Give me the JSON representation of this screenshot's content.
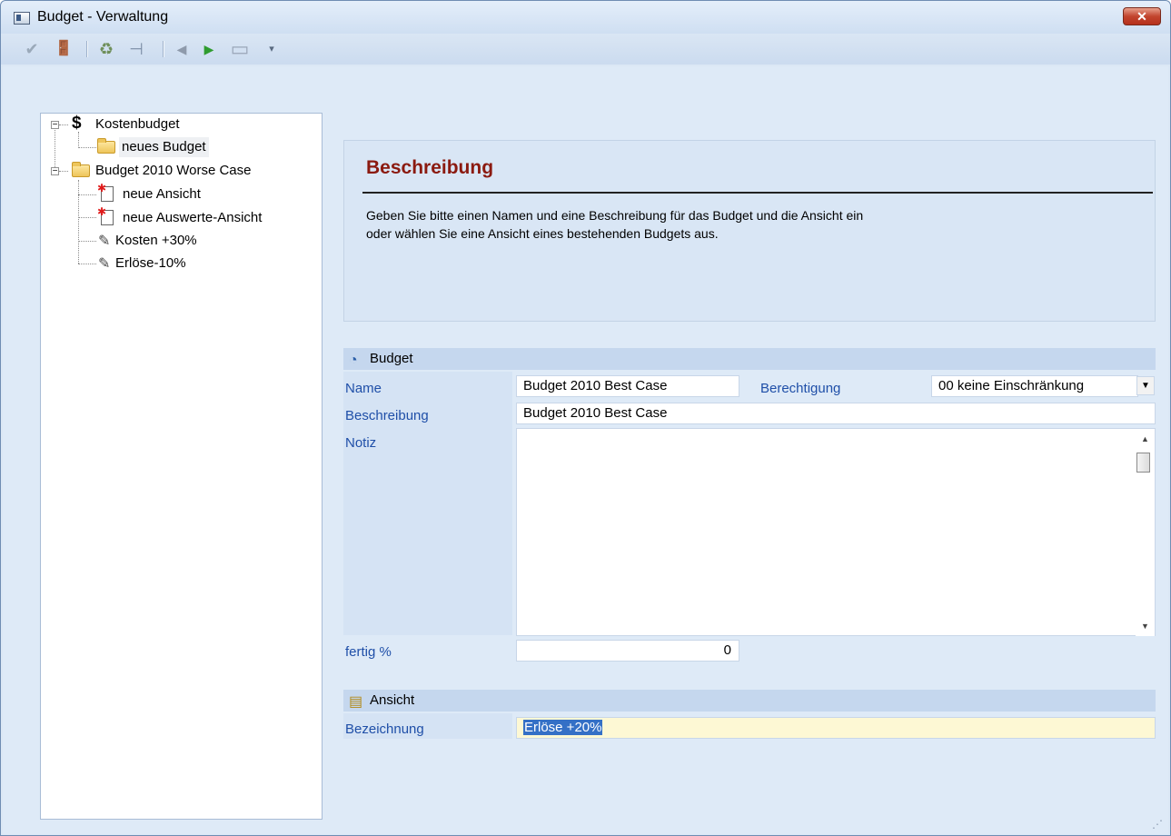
{
  "window": {
    "title": "Budget - Verwaltung",
    "close_label": "✕"
  },
  "toolbar": {
    "buttons": [
      {
        "name": "confirm-icon",
        "glyph": "✔"
      },
      {
        "name": "exit-icon",
        "glyph": "🚪"
      },
      {
        "name": "recycle-icon",
        "glyph": "♻"
      },
      {
        "name": "structure-icon",
        "glyph": "⊣"
      },
      {
        "name": "back-icon",
        "glyph": "◀"
      },
      {
        "name": "forward-icon",
        "glyph": "▶"
      },
      {
        "name": "monitor-icon",
        "glyph": "▭"
      },
      {
        "name": "more-icon",
        "glyph": "▾"
      }
    ]
  },
  "tree": {
    "root_label": "Kostenbudget",
    "root_child_label": "neues Budget",
    "budget_label": "Budget 2010 Worse Case",
    "items": [
      {
        "label": "neue Ansicht"
      },
      {
        "label": "neue Auswerte-Ansicht"
      },
      {
        "label": "Kosten +30%"
      },
      {
        "label": "Erlöse-10%"
      }
    ]
  },
  "description": {
    "title": "Beschreibung",
    "line1": "Geben Sie bitte einen Namen und eine Beschreibung für das Budget und die Ansicht ein",
    "line2": "oder wählen Sie eine Ansicht eines bestehenden Budgets aus."
  },
  "budget": {
    "section_label": "Budget",
    "name_label": "Name",
    "name_value": "Budget 2010 Best Case",
    "permission_label": "Berechtigung",
    "permission_value": "00 keine Einschränkung",
    "description_label": "Beschreibung",
    "description_value": "Budget 2010 Best Case",
    "note_label": "Notiz",
    "note_value": "",
    "done_label": "fertig %",
    "done_value": "0"
  },
  "view": {
    "section_label": "Ansicht",
    "designation_label": "Bezeichnung",
    "designation_value": "Erlöse +20%"
  },
  "colors": {
    "section_title": "#8b1a10",
    "label_blue": "#1f4fa8",
    "selection": "#3470c6"
  }
}
